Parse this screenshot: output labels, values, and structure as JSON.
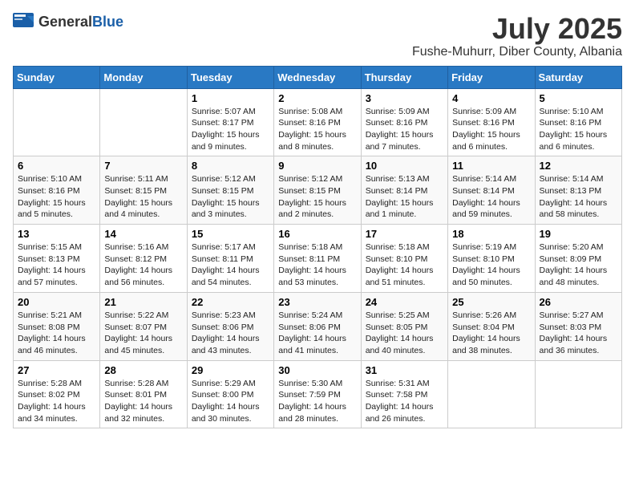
{
  "header": {
    "logo_general": "General",
    "logo_blue": "Blue",
    "month_year": "July 2025",
    "location": "Fushe-Muhurr, Diber County, Albania"
  },
  "weekdays": [
    "Sunday",
    "Monday",
    "Tuesday",
    "Wednesday",
    "Thursday",
    "Friday",
    "Saturday"
  ],
  "weeks": [
    [
      {
        "day": "",
        "info": ""
      },
      {
        "day": "",
        "info": ""
      },
      {
        "day": "1",
        "info": "Sunrise: 5:07 AM\nSunset: 8:17 PM\nDaylight: 15 hours and 9 minutes."
      },
      {
        "day": "2",
        "info": "Sunrise: 5:08 AM\nSunset: 8:16 PM\nDaylight: 15 hours and 8 minutes."
      },
      {
        "day": "3",
        "info": "Sunrise: 5:09 AM\nSunset: 8:16 PM\nDaylight: 15 hours and 7 minutes."
      },
      {
        "day": "4",
        "info": "Sunrise: 5:09 AM\nSunset: 8:16 PM\nDaylight: 15 hours and 6 minutes."
      },
      {
        "day": "5",
        "info": "Sunrise: 5:10 AM\nSunset: 8:16 PM\nDaylight: 15 hours and 6 minutes."
      }
    ],
    [
      {
        "day": "6",
        "info": "Sunrise: 5:10 AM\nSunset: 8:16 PM\nDaylight: 15 hours and 5 minutes."
      },
      {
        "day": "7",
        "info": "Sunrise: 5:11 AM\nSunset: 8:15 PM\nDaylight: 15 hours and 4 minutes."
      },
      {
        "day": "8",
        "info": "Sunrise: 5:12 AM\nSunset: 8:15 PM\nDaylight: 15 hours and 3 minutes."
      },
      {
        "day": "9",
        "info": "Sunrise: 5:12 AM\nSunset: 8:15 PM\nDaylight: 15 hours and 2 minutes."
      },
      {
        "day": "10",
        "info": "Sunrise: 5:13 AM\nSunset: 8:14 PM\nDaylight: 15 hours and 1 minute."
      },
      {
        "day": "11",
        "info": "Sunrise: 5:14 AM\nSunset: 8:14 PM\nDaylight: 14 hours and 59 minutes."
      },
      {
        "day": "12",
        "info": "Sunrise: 5:14 AM\nSunset: 8:13 PM\nDaylight: 14 hours and 58 minutes."
      }
    ],
    [
      {
        "day": "13",
        "info": "Sunrise: 5:15 AM\nSunset: 8:13 PM\nDaylight: 14 hours and 57 minutes."
      },
      {
        "day": "14",
        "info": "Sunrise: 5:16 AM\nSunset: 8:12 PM\nDaylight: 14 hours and 56 minutes."
      },
      {
        "day": "15",
        "info": "Sunrise: 5:17 AM\nSunset: 8:11 PM\nDaylight: 14 hours and 54 minutes."
      },
      {
        "day": "16",
        "info": "Sunrise: 5:18 AM\nSunset: 8:11 PM\nDaylight: 14 hours and 53 minutes."
      },
      {
        "day": "17",
        "info": "Sunrise: 5:18 AM\nSunset: 8:10 PM\nDaylight: 14 hours and 51 minutes."
      },
      {
        "day": "18",
        "info": "Sunrise: 5:19 AM\nSunset: 8:10 PM\nDaylight: 14 hours and 50 minutes."
      },
      {
        "day": "19",
        "info": "Sunrise: 5:20 AM\nSunset: 8:09 PM\nDaylight: 14 hours and 48 minutes."
      }
    ],
    [
      {
        "day": "20",
        "info": "Sunrise: 5:21 AM\nSunset: 8:08 PM\nDaylight: 14 hours and 46 minutes."
      },
      {
        "day": "21",
        "info": "Sunrise: 5:22 AM\nSunset: 8:07 PM\nDaylight: 14 hours and 45 minutes."
      },
      {
        "day": "22",
        "info": "Sunrise: 5:23 AM\nSunset: 8:06 PM\nDaylight: 14 hours and 43 minutes."
      },
      {
        "day": "23",
        "info": "Sunrise: 5:24 AM\nSunset: 8:06 PM\nDaylight: 14 hours and 41 minutes."
      },
      {
        "day": "24",
        "info": "Sunrise: 5:25 AM\nSunset: 8:05 PM\nDaylight: 14 hours and 40 minutes."
      },
      {
        "day": "25",
        "info": "Sunrise: 5:26 AM\nSunset: 8:04 PM\nDaylight: 14 hours and 38 minutes."
      },
      {
        "day": "26",
        "info": "Sunrise: 5:27 AM\nSunset: 8:03 PM\nDaylight: 14 hours and 36 minutes."
      }
    ],
    [
      {
        "day": "27",
        "info": "Sunrise: 5:28 AM\nSunset: 8:02 PM\nDaylight: 14 hours and 34 minutes."
      },
      {
        "day": "28",
        "info": "Sunrise: 5:28 AM\nSunset: 8:01 PM\nDaylight: 14 hours and 32 minutes."
      },
      {
        "day": "29",
        "info": "Sunrise: 5:29 AM\nSunset: 8:00 PM\nDaylight: 14 hours and 30 minutes."
      },
      {
        "day": "30",
        "info": "Sunrise: 5:30 AM\nSunset: 7:59 PM\nDaylight: 14 hours and 28 minutes."
      },
      {
        "day": "31",
        "info": "Sunrise: 5:31 AM\nSunset: 7:58 PM\nDaylight: 14 hours and 26 minutes."
      },
      {
        "day": "",
        "info": ""
      },
      {
        "day": "",
        "info": ""
      }
    ]
  ]
}
